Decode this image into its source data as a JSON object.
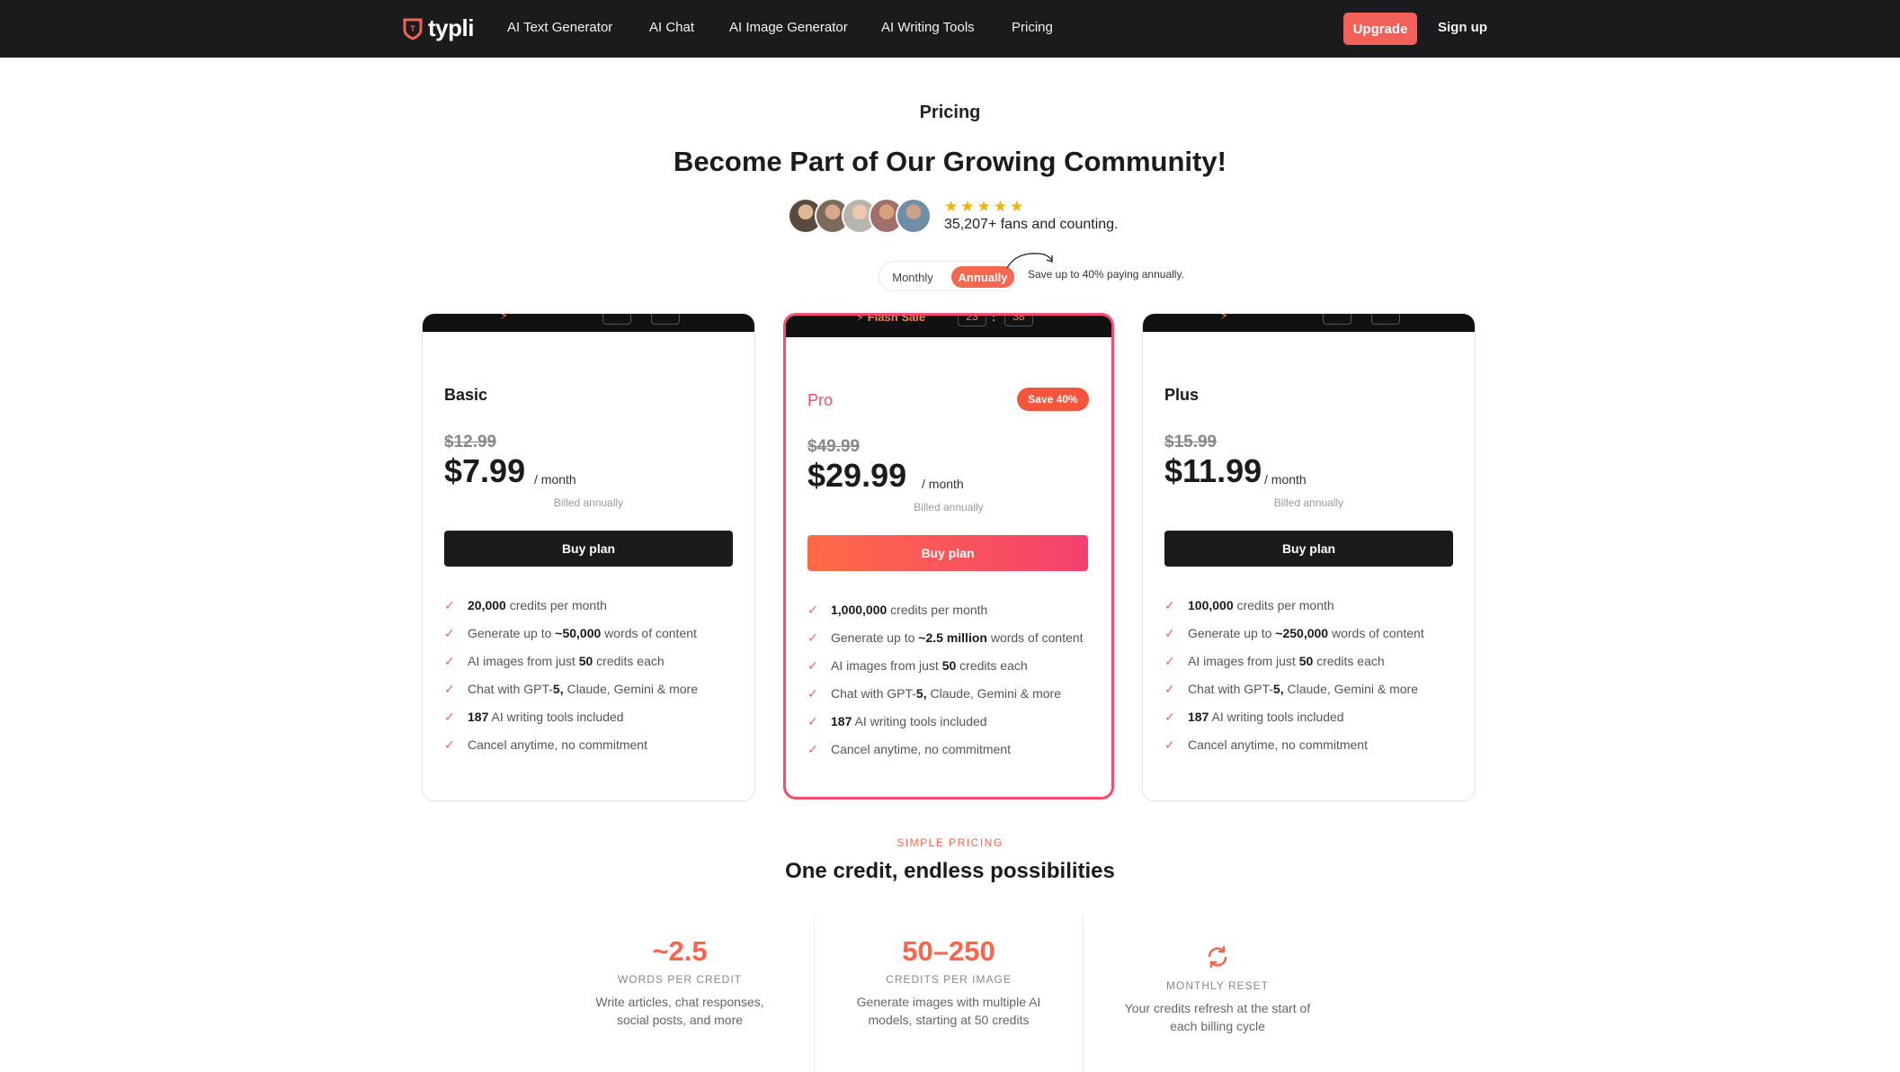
{
  "brand": {
    "logo_text": "typli",
    "accent": "#f2605a"
  },
  "nav": {
    "links": [
      "AI Text Generator",
      "AI Chat",
      "AI Image Generator",
      "AI Writing Tools",
      "Pricing"
    ],
    "upgrade": "Upgrade",
    "signup": "Sign up"
  },
  "header": {
    "eyebrow": "Pricing",
    "headline": "Become Part of Our Growing Community!",
    "stars": "★★★★★",
    "rating": 5,
    "fans": "35,207+ fans and counting."
  },
  "billing": {
    "monthly": "Monthly",
    "annually": "Annually",
    "selected": "Annually",
    "save_note": "Save up to 40% paying annually."
  },
  "flash": {
    "pro_label": "Flash Sale",
    "pro_hours": "23",
    "pro_sep": ":",
    "pro_minutes": "38"
  },
  "plans": [
    {
      "name": "Basic",
      "old_price": "$12.99",
      "price": "$7.99",
      "per": "/ month",
      "billed": "Billed annually",
      "cta": "Buy plan",
      "features": [
        {
          "bold": "20,000",
          "text": " credits per month"
        },
        {
          "pre": "Generate up to ",
          "bold": "~50,000",
          "text": " words of content"
        },
        {
          "pre": "AI images from just ",
          "bold": "50",
          "text": " credits each"
        },
        {
          "pre": "Chat with GPT-",
          "bold": "5,",
          "text": " Claude, Gemini & more"
        },
        {
          "bold": "187",
          "text": " AI writing tools included"
        },
        {
          "text": "Cancel anytime, no commitment"
        }
      ]
    },
    {
      "name": "Pro",
      "badge": "Save 40%",
      "old_price": "$49.99",
      "price": "$29.99",
      "per": "/ month",
      "billed": "Billed annually",
      "cta": "Buy plan",
      "features": [
        {
          "bold": "1,000,000",
          "text": " credits per month"
        },
        {
          "pre": "Generate up to ",
          "bold": "~2.5 million",
          "text": " words of content"
        },
        {
          "pre": "AI images from just ",
          "bold": "50",
          "text": " credits each"
        },
        {
          "pre": "Chat with GPT-",
          "bold": "5,",
          "text": " Claude, Gemini & more"
        },
        {
          "bold": "187",
          "text": " AI writing tools included"
        },
        {
          "text": "Cancel anytime, no commitment"
        }
      ]
    },
    {
      "name": "Plus",
      "old_price": "$15.99",
      "price": "$11.99",
      "per": "/ month",
      "billed": "Billed annually",
      "cta": "Buy plan",
      "features": [
        {
          "bold": "100,000",
          "text": " credits per month"
        },
        {
          "pre": "Generate up to ",
          "bold": "~250,000",
          "text": " words of content"
        },
        {
          "pre": "AI images from just ",
          "bold": "50",
          "text": " credits each"
        },
        {
          "pre": "Chat with GPT-",
          "bold": "5,",
          "text": " Claude, Gemini & more"
        },
        {
          "bold": "187",
          "text": " AI writing tools included"
        },
        {
          "text": "Cancel anytime, no commitment"
        }
      ]
    }
  ],
  "simple_pricing": {
    "eyebrow": "SIMPLE PRICING",
    "title": "One credit, endless possibilities",
    "stats": [
      {
        "value": "~2.5",
        "label": "WORDS PER CREDIT",
        "desc1": "Write articles, chat responses,",
        "desc2": "social posts, and more"
      },
      {
        "value": "50–250",
        "label": "CREDITS PER IMAGE",
        "desc1": "Generate images with multiple AI",
        "desc2": "models, starting at 50 credits"
      },
      {
        "icon": "refresh-icon",
        "label": "MONTHLY RESET",
        "desc1": "Your credits refresh at the start of",
        "desc2": "each billing cycle"
      }
    ]
  }
}
